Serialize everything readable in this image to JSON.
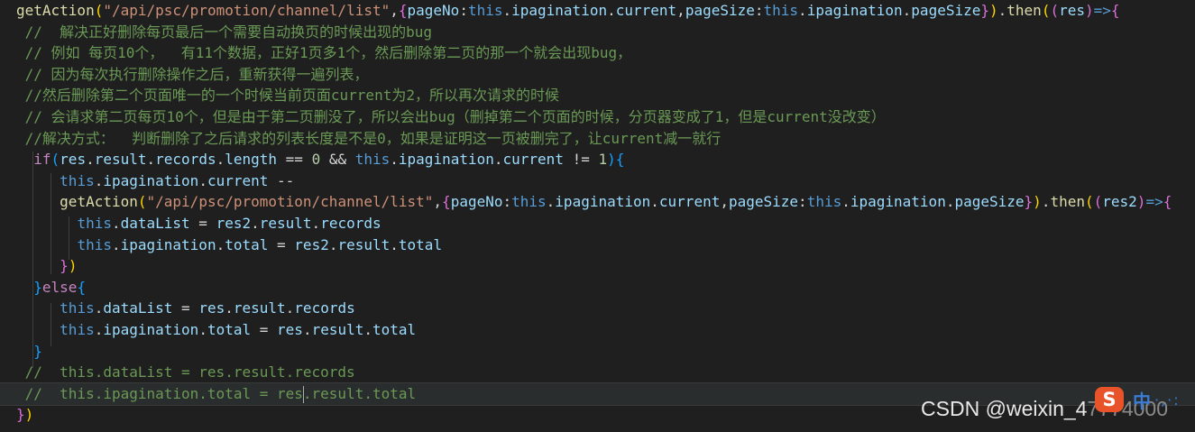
{
  "code_lines": [
    {
      "tokens": [
        {
          "t": "getAction",
          "c": "fn"
        },
        {
          "t": "(",
          "c": "brace"
        },
        {
          "t": "\"/api/psc/promotion/channel/list\"",
          "c": "str"
        },
        {
          "t": ",",
          "c": "plain"
        },
        {
          "t": "{",
          "c": "brace2"
        },
        {
          "t": "pageNo",
          "c": "prop"
        },
        {
          "t": ":",
          "c": "plain"
        },
        {
          "t": "this",
          "c": "kw"
        },
        {
          "t": ".",
          "c": "plain"
        },
        {
          "t": "ipagination",
          "c": "prop"
        },
        {
          "t": ".",
          "c": "plain"
        },
        {
          "t": "current",
          "c": "prop"
        },
        {
          "t": ",",
          "c": "plain"
        },
        {
          "t": "pageSize",
          "c": "prop"
        },
        {
          "t": ":",
          "c": "plain"
        },
        {
          "t": "this",
          "c": "kw"
        },
        {
          "t": ".",
          "c": "plain"
        },
        {
          "t": "ipagination",
          "c": "prop"
        },
        {
          "t": ".",
          "c": "plain"
        },
        {
          "t": "pageSize",
          "c": "prop"
        },
        {
          "t": "}",
          "c": "brace2"
        },
        {
          "t": ")",
          "c": "brace"
        },
        {
          "t": ".",
          "c": "plain"
        },
        {
          "t": "then",
          "c": "fn"
        },
        {
          "t": "(",
          "c": "brace"
        },
        {
          "t": "(",
          "c": "brace2"
        },
        {
          "t": "res",
          "c": "prop"
        },
        {
          "t": ")",
          "c": "brace2"
        },
        {
          "t": "=>",
          "c": "kw"
        },
        {
          "t": "{",
          "c": "brace2"
        }
      ]
    },
    {
      "tokens": [
        {
          "t": " //  解决正好删除每页最后一个需要自动换页的时候出现的bug",
          "c": "com"
        }
      ]
    },
    {
      "tokens": [
        {
          "t": " // 例如 每页10个，  有11个数据，正好1页多1个，然后删除第二页的那一个就会出现bug，",
          "c": "com"
        }
      ]
    },
    {
      "tokens": [
        {
          "t": " // 因为每次执行删除操作之后，重新获得一遍列表，",
          "c": "com"
        }
      ]
    },
    {
      "tokens": [
        {
          "t": " //然后删除第二个页面唯一的一个时候当前页面current为2，所以再次请求的时候",
          "c": "com"
        }
      ]
    },
    {
      "tokens": [
        {
          "t": " // 会请求第二页每页10个，但是由于第二页删没了，所以会出bug（删掉第二个页面的时候，分页器变成了1，但是current没改变）",
          "c": "com"
        }
      ]
    },
    {
      "tokens": [
        {
          "t": " //解决方式：  判断删除了之后请求的列表长度是不是0，如果是证明这一页被删完了，让current减一就行",
          "c": "com"
        }
      ]
    },
    {
      "tokens": [
        {
          "t": "  ",
          "c": "plain"
        },
        {
          "t": "if",
          "c": "ctl"
        },
        {
          "t": "(",
          "c": "brace3"
        },
        {
          "t": "res",
          "c": "prop"
        },
        {
          "t": ".",
          "c": "plain"
        },
        {
          "t": "result",
          "c": "prop"
        },
        {
          "t": ".",
          "c": "plain"
        },
        {
          "t": "records",
          "c": "prop"
        },
        {
          "t": ".",
          "c": "plain"
        },
        {
          "t": "length",
          "c": "prop"
        },
        {
          "t": " == ",
          "c": "op"
        },
        {
          "t": "0",
          "c": "num"
        },
        {
          "t": " && ",
          "c": "op"
        },
        {
          "t": "this",
          "c": "kw"
        },
        {
          "t": ".",
          "c": "plain"
        },
        {
          "t": "ipagination",
          "c": "prop"
        },
        {
          "t": ".",
          "c": "plain"
        },
        {
          "t": "current",
          "c": "prop"
        },
        {
          "t": " != ",
          "c": "op"
        },
        {
          "t": "1",
          "c": "num"
        },
        {
          "t": ")",
          "c": "brace3"
        },
        {
          "t": "{",
          "c": "brace3"
        }
      ]
    },
    {
      "tokens": [
        {
          "t": "     ",
          "c": "plain"
        },
        {
          "t": "this",
          "c": "kw"
        },
        {
          "t": ".",
          "c": "plain"
        },
        {
          "t": "ipagination",
          "c": "prop"
        },
        {
          "t": ".",
          "c": "plain"
        },
        {
          "t": "current",
          "c": "prop"
        },
        {
          "t": " --",
          "c": "op"
        }
      ]
    },
    {
      "tokens": [
        {
          "t": "     ",
          "c": "plain"
        },
        {
          "t": "getAction",
          "c": "fn"
        },
        {
          "t": "(",
          "c": "brace"
        },
        {
          "t": "\"/api/psc/promotion/channel/list\"",
          "c": "str"
        },
        {
          "t": ",",
          "c": "plain"
        },
        {
          "t": "{",
          "c": "brace2"
        },
        {
          "t": "pageNo",
          "c": "prop"
        },
        {
          "t": ":",
          "c": "plain"
        },
        {
          "t": "this",
          "c": "kw"
        },
        {
          "t": ".",
          "c": "plain"
        },
        {
          "t": "ipagination",
          "c": "prop"
        },
        {
          "t": ".",
          "c": "plain"
        },
        {
          "t": "current",
          "c": "prop"
        },
        {
          "t": ",",
          "c": "plain"
        },
        {
          "t": "pageSize",
          "c": "prop"
        },
        {
          "t": ":",
          "c": "plain"
        },
        {
          "t": "this",
          "c": "kw"
        },
        {
          "t": ".",
          "c": "plain"
        },
        {
          "t": "ipagination",
          "c": "prop"
        },
        {
          "t": ".",
          "c": "plain"
        },
        {
          "t": "pageSize",
          "c": "prop"
        },
        {
          "t": "}",
          "c": "brace2"
        },
        {
          "t": ")",
          "c": "brace"
        },
        {
          "t": ".",
          "c": "plain"
        },
        {
          "t": "then",
          "c": "fn"
        },
        {
          "t": "(",
          "c": "brace"
        },
        {
          "t": "(",
          "c": "brace2"
        },
        {
          "t": "res2",
          "c": "prop"
        },
        {
          "t": ")",
          "c": "brace2"
        },
        {
          "t": "=>",
          "c": "kw"
        },
        {
          "t": "{",
          "c": "brace2"
        }
      ]
    },
    {
      "tokens": [
        {
          "t": "       ",
          "c": "plain"
        },
        {
          "t": "this",
          "c": "kw"
        },
        {
          "t": ".",
          "c": "plain"
        },
        {
          "t": "dataList",
          "c": "prop"
        },
        {
          "t": " = ",
          "c": "op"
        },
        {
          "t": "res2",
          "c": "prop"
        },
        {
          "t": ".",
          "c": "plain"
        },
        {
          "t": "result",
          "c": "prop"
        },
        {
          "t": ".",
          "c": "plain"
        },
        {
          "t": "records",
          "c": "prop"
        }
      ]
    },
    {
      "tokens": [
        {
          "t": "       ",
          "c": "plain"
        },
        {
          "t": "this",
          "c": "kw"
        },
        {
          "t": ".",
          "c": "plain"
        },
        {
          "t": "ipagination",
          "c": "prop"
        },
        {
          "t": ".",
          "c": "plain"
        },
        {
          "t": "total",
          "c": "prop"
        },
        {
          "t": " = ",
          "c": "op"
        },
        {
          "t": "res2",
          "c": "prop"
        },
        {
          "t": ".",
          "c": "plain"
        },
        {
          "t": "result",
          "c": "prop"
        },
        {
          "t": ".",
          "c": "plain"
        },
        {
          "t": "total",
          "c": "prop"
        }
      ]
    },
    {
      "tokens": [
        {
          "t": "     ",
          "c": "plain"
        },
        {
          "t": "}",
          "c": "brace2"
        },
        {
          "t": ")",
          "c": "brace"
        }
      ]
    },
    {
      "tokens": [
        {
          "t": "  ",
          "c": "plain"
        },
        {
          "t": "}",
          "c": "brace3"
        },
        {
          "t": "else",
          "c": "ctl"
        },
        {
          "t": "{",
          "c": "brace3"
        }
      ]
    },
    {
      "tokens": [
        {
          "t": "     ",
          "c": "plain"
        },
        {
          "t": "this",
          "c": "kw"
        },
        {
          "t": ".",
          "c": "plain"
        },
        {
          "t": "dataList",
          "c": "prop"
        },
        {
          "t": " = ",
          "c": "op"
        },
        {
          "t": "res",
          "c": "prop"
        },
        {
          "t": ".",
          "c": "plain"
        },
        {
          "t": "result",
          "c": "prop"
        },
        {
          "t": ".",
          "c": "plain"
        },
        {
          "t": "records",
          "c": "prop"
        }
      ]
    },
    {
      "tokens": [
        {
          "t": "     ",
          "c": "plain"
        },
        {
          "t": "this",
          "c": "kw"
        },
        {
          "t": ".",
          "c": "plain"
        },
        {
          "t": "ipagination",
          "c": "prop"
        },
        {
          "t": ".",
          "c": "plain"
        },
        {
          "t": "total",
          "c": "prop"
        },
        {
          "t": " = ",
          "c": "op"
        },
        {
          "t": "res",
          "c": "prop"
        },
        {
          "t": ".",
          "c": "plain"
        },
        {
          "t": "result",
          "c": "prop"
        },
        {
          "t": ".",
          "c": "plain"
        },
        {
          "t": "total",
          "c": "prop"
        }
      ]
    },
    {
      "tokens": [
        {
          "t": "  ",
          "c": "plain"
        },
        {
          "t": "}",
          "c": "brace3"
        }
      ]
    },
    {
      "tokens": [
        {
          "t": " //  this.dataList = res.result.records",
          "c": "com"
        }
      ]
    },
    {
      "tokens": [
        {
          "t": " //  this.ipagination.total = res",
          "c": "com"
        },
        {
          "t": "",
          "c": "caret"
        },
        {
          "t": ".result.total",
          "c": "com"
        }
      ],
      "current": true
    },
    {
      "tokens": [
        {
          "t": "}",
          "c": "brace2"
        },
        {
          "t": ")",
          "c": "brace"
        }
      ]
    }
  ],
  "watermark": {
    "text": "CSDN @weixin_4",
    "fade": "7774000"
  },
  "ime": {
    "logo": "S",
    "mode": "中",
    "dots": "·,·:"
  },
  "colors": {
    "background": "#1f1f1f",
    "function": "#dcdcaa",
    "string": "#ce9178",
    "keyword": "#569cd6",
    "control": "#c586c0",
    "property": "#9cdcfe",
    "number": "#b5cea8",
    "comment": "#6a9955",
    "brace1": "#ffd700",
    "brace2": "#da70d6",
    "brace3": "#179fff"
  }
}
